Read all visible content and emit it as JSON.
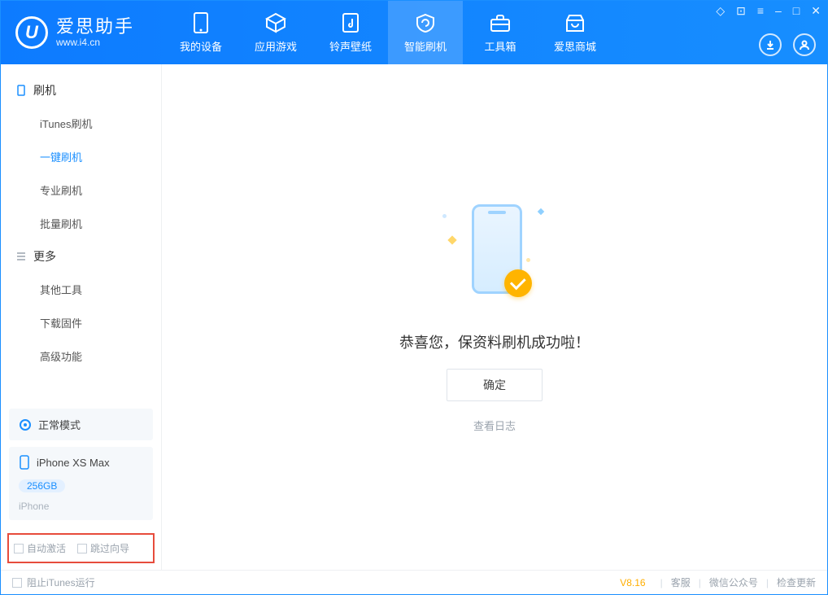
{
  "logo": {
    "cn": "爱思助手",
    "en": "www.i4.cn"
  },
  "tabs": [
    {
      "label": "我的设备"
    },
    {
      "label": "应用游戏"
    },
    {
      "label": "铃声壁纸"
    },
    {
      "label": "智能刷机"
    },
    {
      "label": "工具箱"
    },
    {
      "label": "爱思商城"
    }
  ],
  "sidebar": {
    "group1_title": "刷机",
    "group1_items": [
      "iTunes刷机",
      "一键刷机",
      "专业刷机",
      "批量刷机"
    ],
    "group2_title": "更多",
    "group2_items": [
      "其他工具",
      "下载固件",
      "高级功能"
    ]
  },
  "mode_card": {
    "label": "正常模式"
  },
  "device_card": {
    "name": "iPhone XS Max",
    "storage": "256GB",
    "type": "iPhone"
  },
  "bottom_checks": {
    "auto_activate": "自动激活",
    "skip_guide": "跳过向导"
  },
  "main": {
    "success_text": "恭喜您，保资料刷机成功啦！",
    "ok_button": "确定",
    "view_log": "查看日志"
  },
  "footer": {
    "block_itunes": "阻止iTunes运行",
    "version": "V8.16",
    "links": [
      "客服",
      "微信公众号",
      "检查更新"
    ]
  }
}
